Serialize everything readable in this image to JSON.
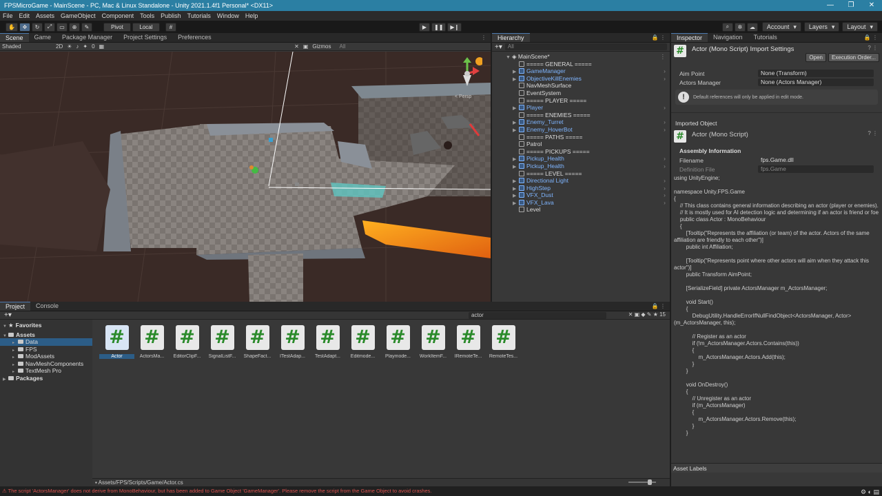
{
  "window": {
    "title": "FPSMicroGame - MainScene - PC, Mac & Linux Standalone - Unity 2021.1.4f1 Personal* <DX11>",
    "controls": [
      "—",
      "❐",
      "✕"
    ]
  },
  "menu": [
    "File",
    "Edit",
    "Assets",
    "GameObject",
    "Component",
    "Tools",
    "Publish",
    "Tutorials",
    "Window",
    "Help"
  ],
  "toolbar": {
    "pivot": "Pivot",
    "local": "Local",
    "account": "Account",
    "layers": "Layers",
    "layout": "Layout"
  },
  "scene_tabs": [
    "Scene",
    "Game",
    "Package Manager",
    "Project Settings",
    "Preferences"
  ],
  "scene_bar": {
    "shading": "Shaded",
    "mode_2d": "2D",
    "fx_count": "0",
    "gizmos": "Gizmos",
    "search_hint": "All",
    "persp": "< Persp"
  },
  "hierarchy": {
    "tab": "Hierarchy",
    "search_hint": "All",
    "scene": "MainScene*",
    "items": [
      {
        "label": "===== GENERAL =====",
        "blue": false
      },
      {
        "label": "GameManager",
        "blue": true
      },
      {
        "label": "ObjectiveKillEnemies",
        "blue": true
      },
      {
        "label": "NavMeshSurface",
        "blue": false
      },
      {
        "label": "EventSystem",
        "blue": false
      },
      {
        "label": "===== PLAYER =====",
        "blue": false
      },
      {
        "label": "Player",
        "blue": true
      },
      {
        "label": "===== ENEMIES =====",
        "blue": false
      },
      {
        "label": "Enemy_Turret",
        "blue": true
      },
      {
        "label": "Enemy_HoverBot",
        "blue": true
      },
      {
        "label": "===== PATHS =====",
        "blue": false
      },
      {
        "label": "Patrol",
        "blue": false
      },
      {
        "label": "===== PICKUPS =====",
        "blue": false
      },
      {
        "label": "Pickup_Health",
        "blue": true
      },
      {
        "label": "Pickup_Health",
        "blue": true
      },
      {
        "label": "===== LEVEL =====",
        "blue": false
      },
      {
        "label": "Directional Light",
        "blue": true
      },
      {
        "label": "HighStep",
        "blue": true
      },
      {
        "label": "VFX_Dust",
        "blue": true
      },
      {
        "label": "VFX_Lava",
        "blue": true
      },
      {
        "label": "Level",
        "blue": false
      }
    ]
  },
  "inspector": {
    "tabs": [
      "Inspector",
      "Navigation",
      "Tutorials"
    ],
    "title": "Actor (Mono Script) Import Settings",
    "open": "Open",
    "execution_order": "Execution Order...",
    "aim_point_label": "Aim Point",
    "aim_point_value": "None (Transform)",
    "actors_manager_label": "Actors Manager",
    "actors_manager_value": "None (Actors Manager)",
    "help": "Default references will only be applied in edit mode.",
    "imported_object": "Imported Object",
    "object_title": "Actor (Mono Script)",
    "assembly_info": "Assembly Information",
    "filename_label": "Filename",
    "filename_value": "fps.Game.dll",
    "definition_label": "Definition File",
    "definition_value": "fps.Game",
    "code": "using UnityEngine;\n\nnamespace Unity.FPS.Game\n{\n    // This class contains general information describing an actor (player or enemies).\n    // It is mostly used for AI detection logic and determining if an actor is friend or foe\n    public class Actor : MonoBehaviour\n    {\n        [Tooltip(\"Represents the affiliation (or team) of the actor. Actors of the same affiliation are friendly to each other\")]\n        public int Affiliation;\n\n        [Tooltip(\"Represents point where other actors will aim when they attack this actor\")]\n        public Transform AimPoint;\n\n        [SerializeField] private ActorsManager m_ActorsManager;\n\n        void Start()\n        {\n            DebugUtility.HandleErrorIfNullFindObject<ActorsManager, Actor>(m_ActorsManager, this);\n\n            // Register as an actor\n            if (!m_ActorsManager.Actors.Contains(this))\n            {\n                m_ActorsManager.Actors.Add(this);\n            }\n        }\n\n        void OnDestroy()\n        {\n            // Unregister as an actor\n            if (m_ActorsManager)\n            {\n                m_ActorsManager.Actors.Remove(this);\n            }\n        }",
    "asset_labels": "Asset Labels"
  },
  "project": {
    "tabs": [
      "Project",
      "Console"
    ],
    "search": "actor",
    "count": "15",
    "tree": [
      {
        "label": "Favorites",
        "kind": "fav",
        "indent": 0
      },
      {
        "label": "Assets",
        "kind": "folder",
        "indent": 0
      },
      {
        "label": "Data",
        "kind": "folder",
        "indent": 1,
        "selected": true
      },
      {
        "label": "FPS",
        "kind": "folder",
        "indent": 1
      },
      {
        "label": "ModAssets",
        "kind": "folder",
        "indent": 1
      },
      {
        "label": "NavMeshComponents",
        "kind": "folder",
        "indent": 1
      },
      {
        "label": "TextMesh Pro",
        "kind": "folder",
        "indent": 1
      },
      {
        "label": "Packages",
        "kind": "folder",
        "indent": 0
      }
    ],
    "assets": [
      "Actor",
      "ActorsMa...",
      "EditorClipF...",
      "SignalListF...",
      "ShapeFact...",
      "ITestAdap...",
      "TestAdapt...",
      "Editmode...",
      "Playmode...",
      "WorkItemF...",
      "IRemoteTe...",
      "RemoteTes..."
    ],
    "path": "Assets/FPS/Scripts/Game/Actor.cs"
  },
  "status": "The script 'ActorsManager' does not derive from MonoBehaviour, but has been added to Game Object 'GameManager'. Please remove the script from the Game Object to avoid crashes.",
  "colors": {
    "accent": "#2b7fa3",
    "selection": "#2c5d87",
    "prefab": "#7fb5ff",
    "error": "#d9534f",
    "lava": "#f0a020"
  }
}
